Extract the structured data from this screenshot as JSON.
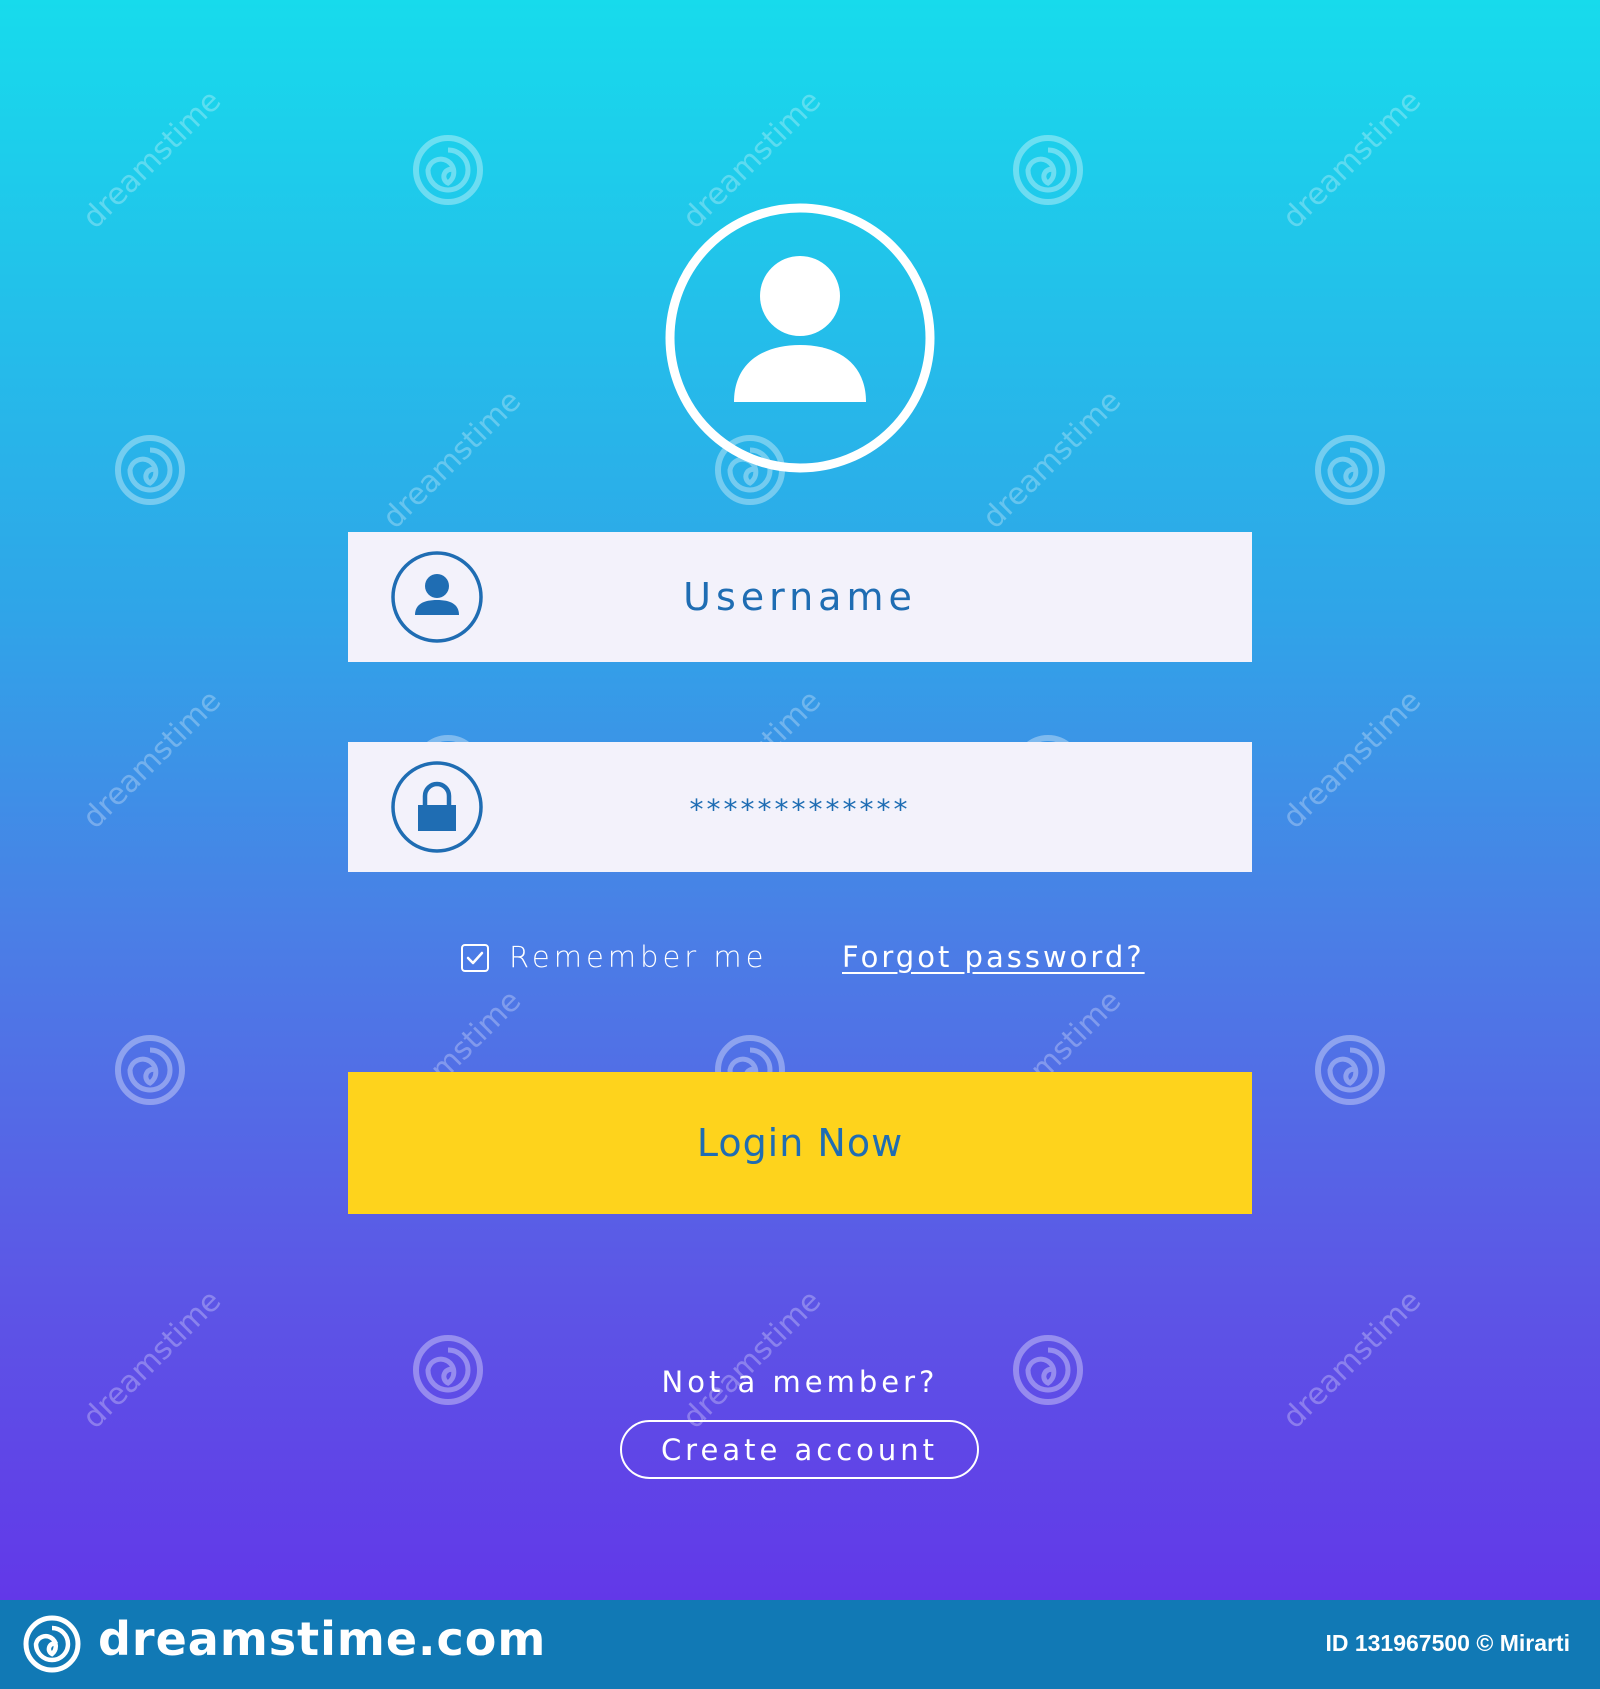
{
  "form": {
    "username_placeholder": "Username",
    "password_value": "*************",
    "remember_label": "Remember me",
    "remember_checked": true,
    "forgot_link": "Forgot password?",
    "login_button": "Login Now",
    "not_member": "Not a member?",
    "create_account": "Create account"
  },
  "icons": {
    "avatar": "user-avatar-icon",
    "username": "user-icon",
    "password": "lock-icon",
    "checkbox": "checkmark-icon"
  },
  "footer": {
    "logo": "dreamstime.com",
    "credit": "ID 131967500 © Mirarti"
  },
  "watermark": {
    "text": "dreamstime"
  },
  "colors": {
    "gradient_top": "#17dbec",
    "gradient_bottom": "#6238e8",
    "field_bg": "#f3f2fb",
    "field_text": "#1f6db3",
    "button_bg": "#fed31c",
    "footer_bg": "#1179b5"
  }
}
